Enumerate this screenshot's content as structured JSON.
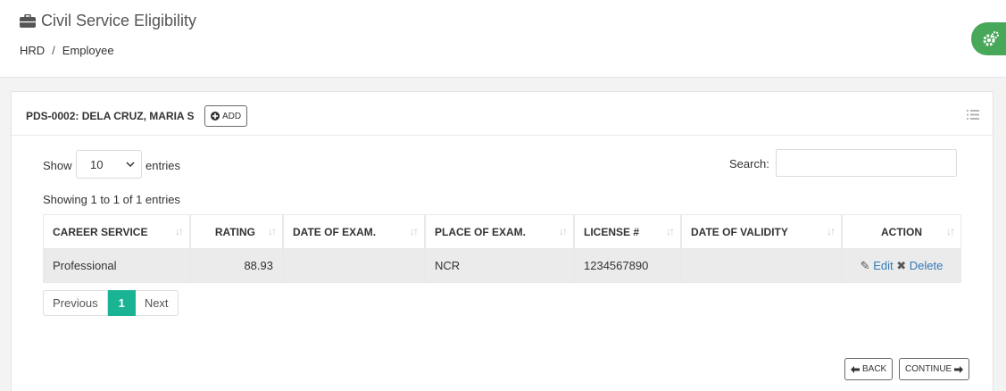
{
  "header": {
    "title": "Civil Service Eligibility",
    "title_icon": "briefcase-icon",
    "breadcrumb": [
      "HRD",
      "Employee"
    ],
    "breadcrumb_separator": "/"
  },
  "fab": {
    "icon": "gears-icon",
    "color": "#48a85a"
  },
  "panel": {
    "title": "PDS-0002: DELA CRUZ, MARIA S",
    "add_label": "ADD",
    "menu_icon": "list-icon"
  },
  "table_controls": {
    "show_label": "Show",
    "entries_value": "10",
    "entries_label": "entries",
    "search_label": "Search:",
    "search_value": "",
    "info": "Showing 1 to 1 of 1 entries"
  },
  "table": {
    "columns": [
      "CAREER SERVICE",
      "RATING",
      "DATE OF EXAM.",
      "PLACE OF EXAM.",
      "LICENSE #",
      "DATE OF VALIDITY",
      "ACTION"
    ],
    "rows": [
      {
        "career_service": "Professional",
        "rating": "88.93",
        "date_of_exam": "",
        "place_of_exam": "NCR",
        "license": "1234567890",
        "date_of_validity": "",
        "edit_label": "Edit",
        "delete_label": "Delete"
      }
    ]
  },
  "pagination": {
    "previous": "Previous",
    "current": "1",
    "next": "Next",
    "active_color": "#1ab394"
  },
  "footer": {
    "back_label": "BACK",
    "continue_label": "CONTINUE"
  }
}
